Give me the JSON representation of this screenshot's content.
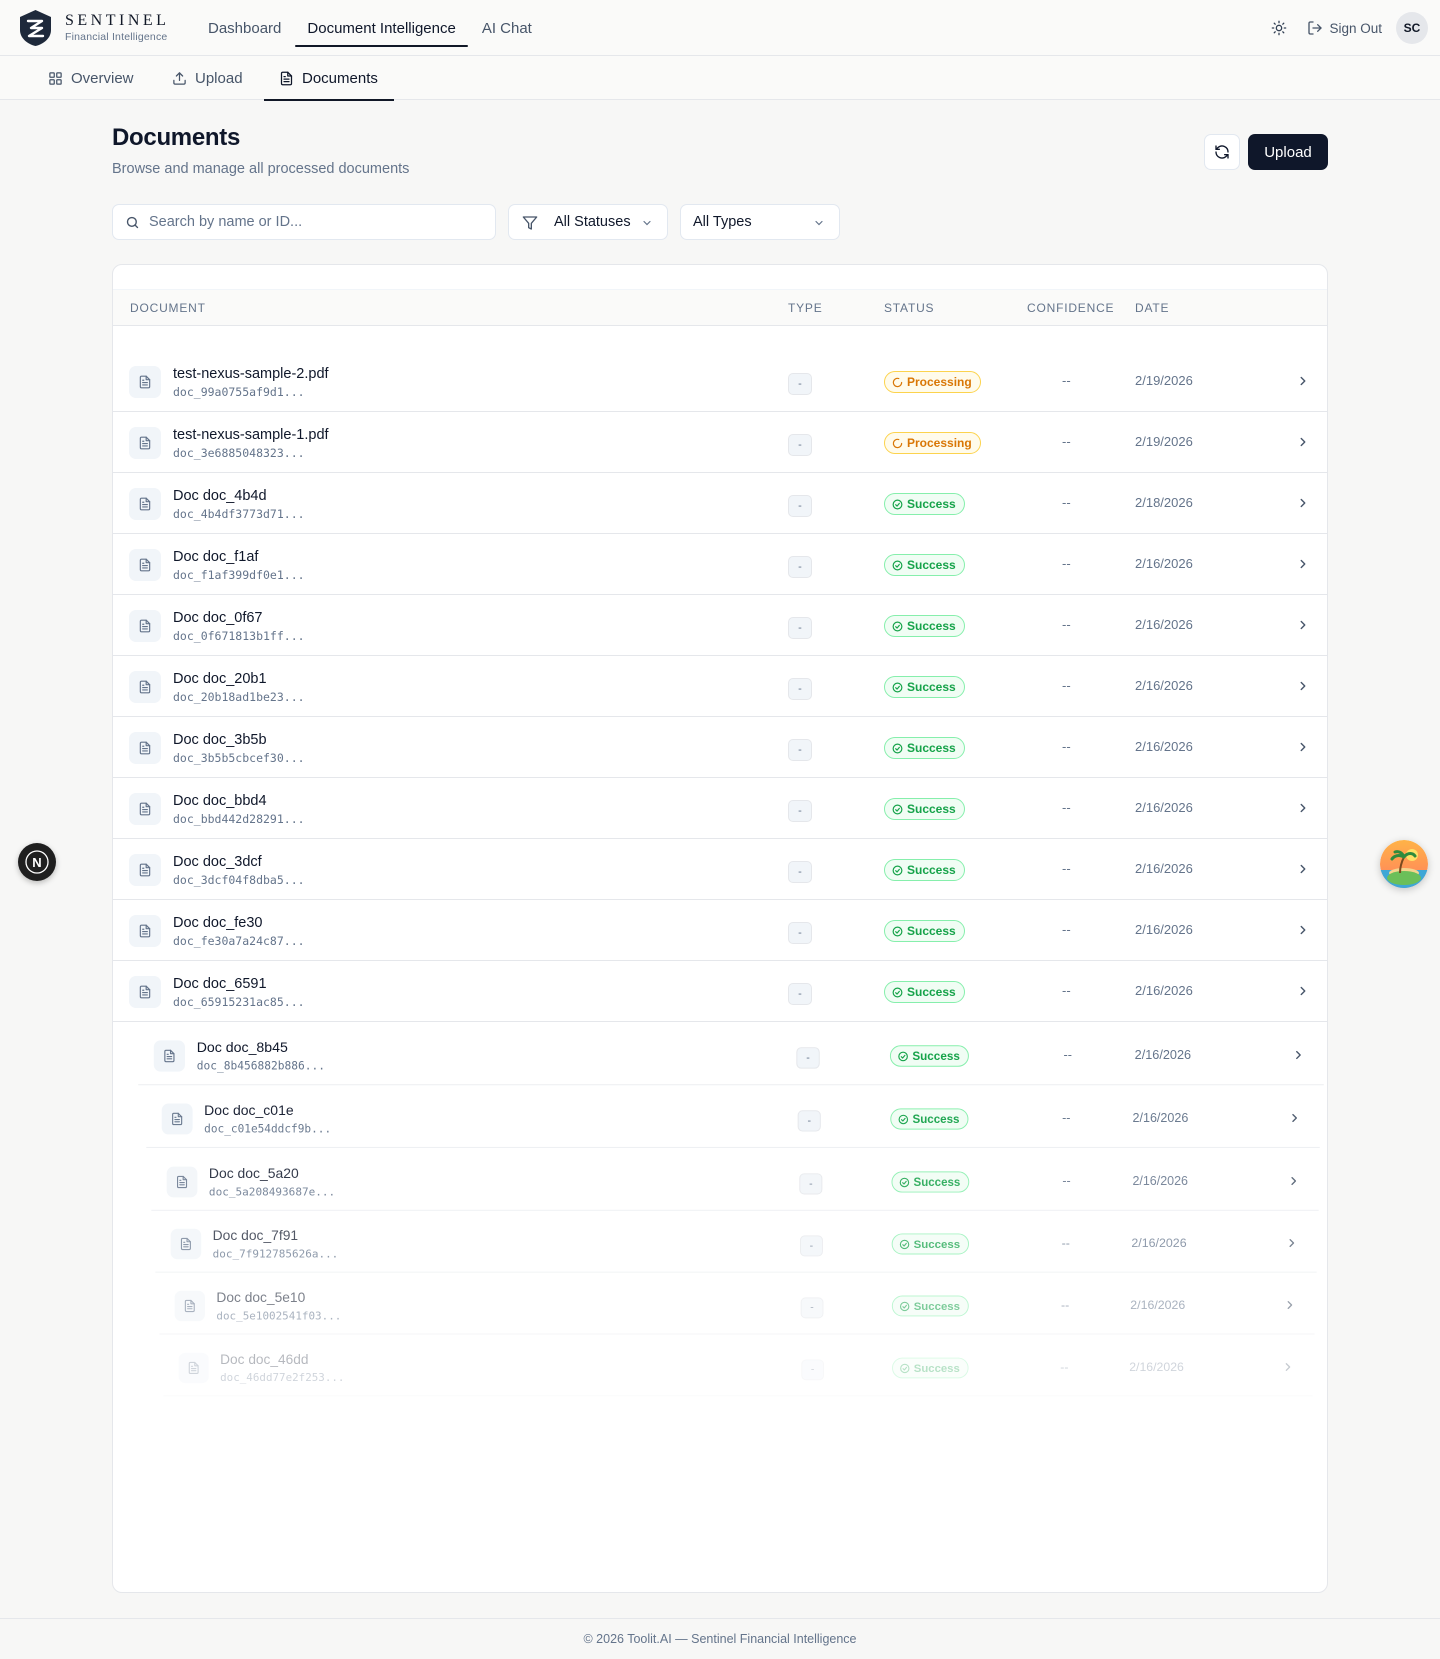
{
  "brand": {
    "name": "SENTINEL",
    "subtitle": "Financial Intelligence"
  },
  "topnav": [
    {
      "label": "Dashboard",
      "active": false
    },
    {
      "label": "Document Intelligence",
      "active": true
    },
    {
      "label": "AI Chat",
      "active": false
    }
  ],
  "header_actions": {
    "sign_out": "Sign Out",
    "avatar_initials": "SC"
  },
  "subnav": [
    {
      "label": "Overview",
      "icon": "grid-icon",
      "active": false
    },
    {
      "label": "Upload",
      "icon": "upload-icon",
      "active": false
    },
    {
      "label": "Documents",
      "icon": "file-icon",
      "active": true
    }
  ],
  "page": {
    "title": "Documents",
    "subtitle": "Browse and manage all processed documents",
    "upload_label": "Upload"
  },
  "filters": {
    "search_placeholder": "Search by name or ID...",
    "status_selected": "All Statuses",
    "type_selected": "All Types"
  },
  "table": {
    "columns": [
      "DOCUMENT",
      "TYPE",
      "STATUS",
      "CONFIDENCE",
      "DATE"
    ],
    "rows": [
      {
        "name": "test-nexus-sample-2.pdf",
        "id": "doc_99a0755af9d1...",
        "type": "-",
        "status": "Processing",
        "confidence": "--",
        "date": "2/19/2026"
      },
      {
        "name": "test-nexus-sample-1.pdf",
        "id": "doc_3e6885048323...",
        "type": "-",
        "status": "Processing",
        "confidence": "--",
        "date": "2/19/2026"
      },
      {
        "name": "Doc doc_4b4d",
        "id": "doc_4b4df3773d71...",
        "type": "-",
        "status": "Success",
        "confidence": "--",
        "date": "2/18/2026"
      },
      {
        "name": "Doc doc_f1af",
        "id": "doc_f1af399df0e1...",
        "type": "-",
        "status": "Success",
        "confidence": "--",
        "date": "2/16/2026"
      },
      {
        "name": "Doc doc_0f67",
        "id": "doc_0f671813b1ff...",
        "type": "-",
        "status": "Success",
        "confidence": "--",
        "date": "2/16/2026"
      },
      {
        "name": "Doc doc_20b1",
        "id": "doc_20b18ad1be23...",
        "type": "-",
        "status": "Success",
        "confidence": "--",
        "date": "2/16/2026"
      },
      {
        "name": "Doc doc_3b5b",
        "id": "doc_3b5b5cbcef30...",
        "type": "-",
        "status": "Success",
        "confidence": "--",
        "date": "2/16/2026"
      },
      {
        "name": "Doc doc_bbd4",
        "id": "doc_bbd442d28291...",
        "type": "-",
        "status": "Success",
        "confidence": "--",
        "date": "2/16/2026"
      },
      {
        "name": "Doc doc_3dcf",
        "id": "doc_3dcf04f8dba5...",
        "type": "-",
        "status": "Success",
        "confidence": "--",
        "date": "2/16/2026"
      },
      {
        "name": "Doc doc_fe30",
        "id": "doc_fe30a7a24c87...",
        "type": "-",
        "status": "Success",
        "confidence": "--",
        "date": "2/16/2026"
      },
      {
        "name": "Doc doc_6591",
        "id": "doc_65915231ac85...",
        "type": "-",
        "status": "Success",
        "confidence": "--",
        "date": "2/16/2026"
      },
      {
        "name": "Doc doc_8b45",
        "id": "doc_8b456882b886...",
        "type": "-",
        "status": "Success",
        "confidence": "--",
        "date": "2/16/2026"
      },
      {
        "name": "Doc doc_c01e",
        "id": "doc_c01e54ddcf9b...",
        "type": "-",
        "status": "Success",
        "confidence": "--",
        "date": "2/16/2026"
      },
      {
        "name": "Doc doc_5a20",
        "id": "doc_5a208493687e...",
        "type": "-",
        "status": "Success",
        "confidence": "--",
        "date": "2/16/2026"
      },
      {
        "name": "Doc doc_7f91",
        "id": "doc_7f912785626a...",
        "type": "-",
        "status": "Success",
        "confidence": "--",
        "date": "2/16/2026"
      },
      {
        "name": "Doc doc_5e10",
        "id": "doc_5e1002541f03...",
        "type": "-",
        "status": "Success",
        "confidence": "--",
        "date": "2/16/2026"
      },
      {
        "name": "Doc doc_46dd",
        "id": "doc_46dd77e2f253...",
        "type": "-",
        "status": "Success",
        "confidence": "--",
        "date": "2/16/2026"
      }
    ]
  },
  "floating": {
    "left_badge": "N"
  },
  "footer": {
    "text": "© 2026 Toolit.AI — Sentinel Financial Intelligence"
  },
  "colors": {
    "primary": "#0f172a",
    "processing": "#d97706",
    "success": "#16a34a",
    "muted": "#64748b"
  }
}
